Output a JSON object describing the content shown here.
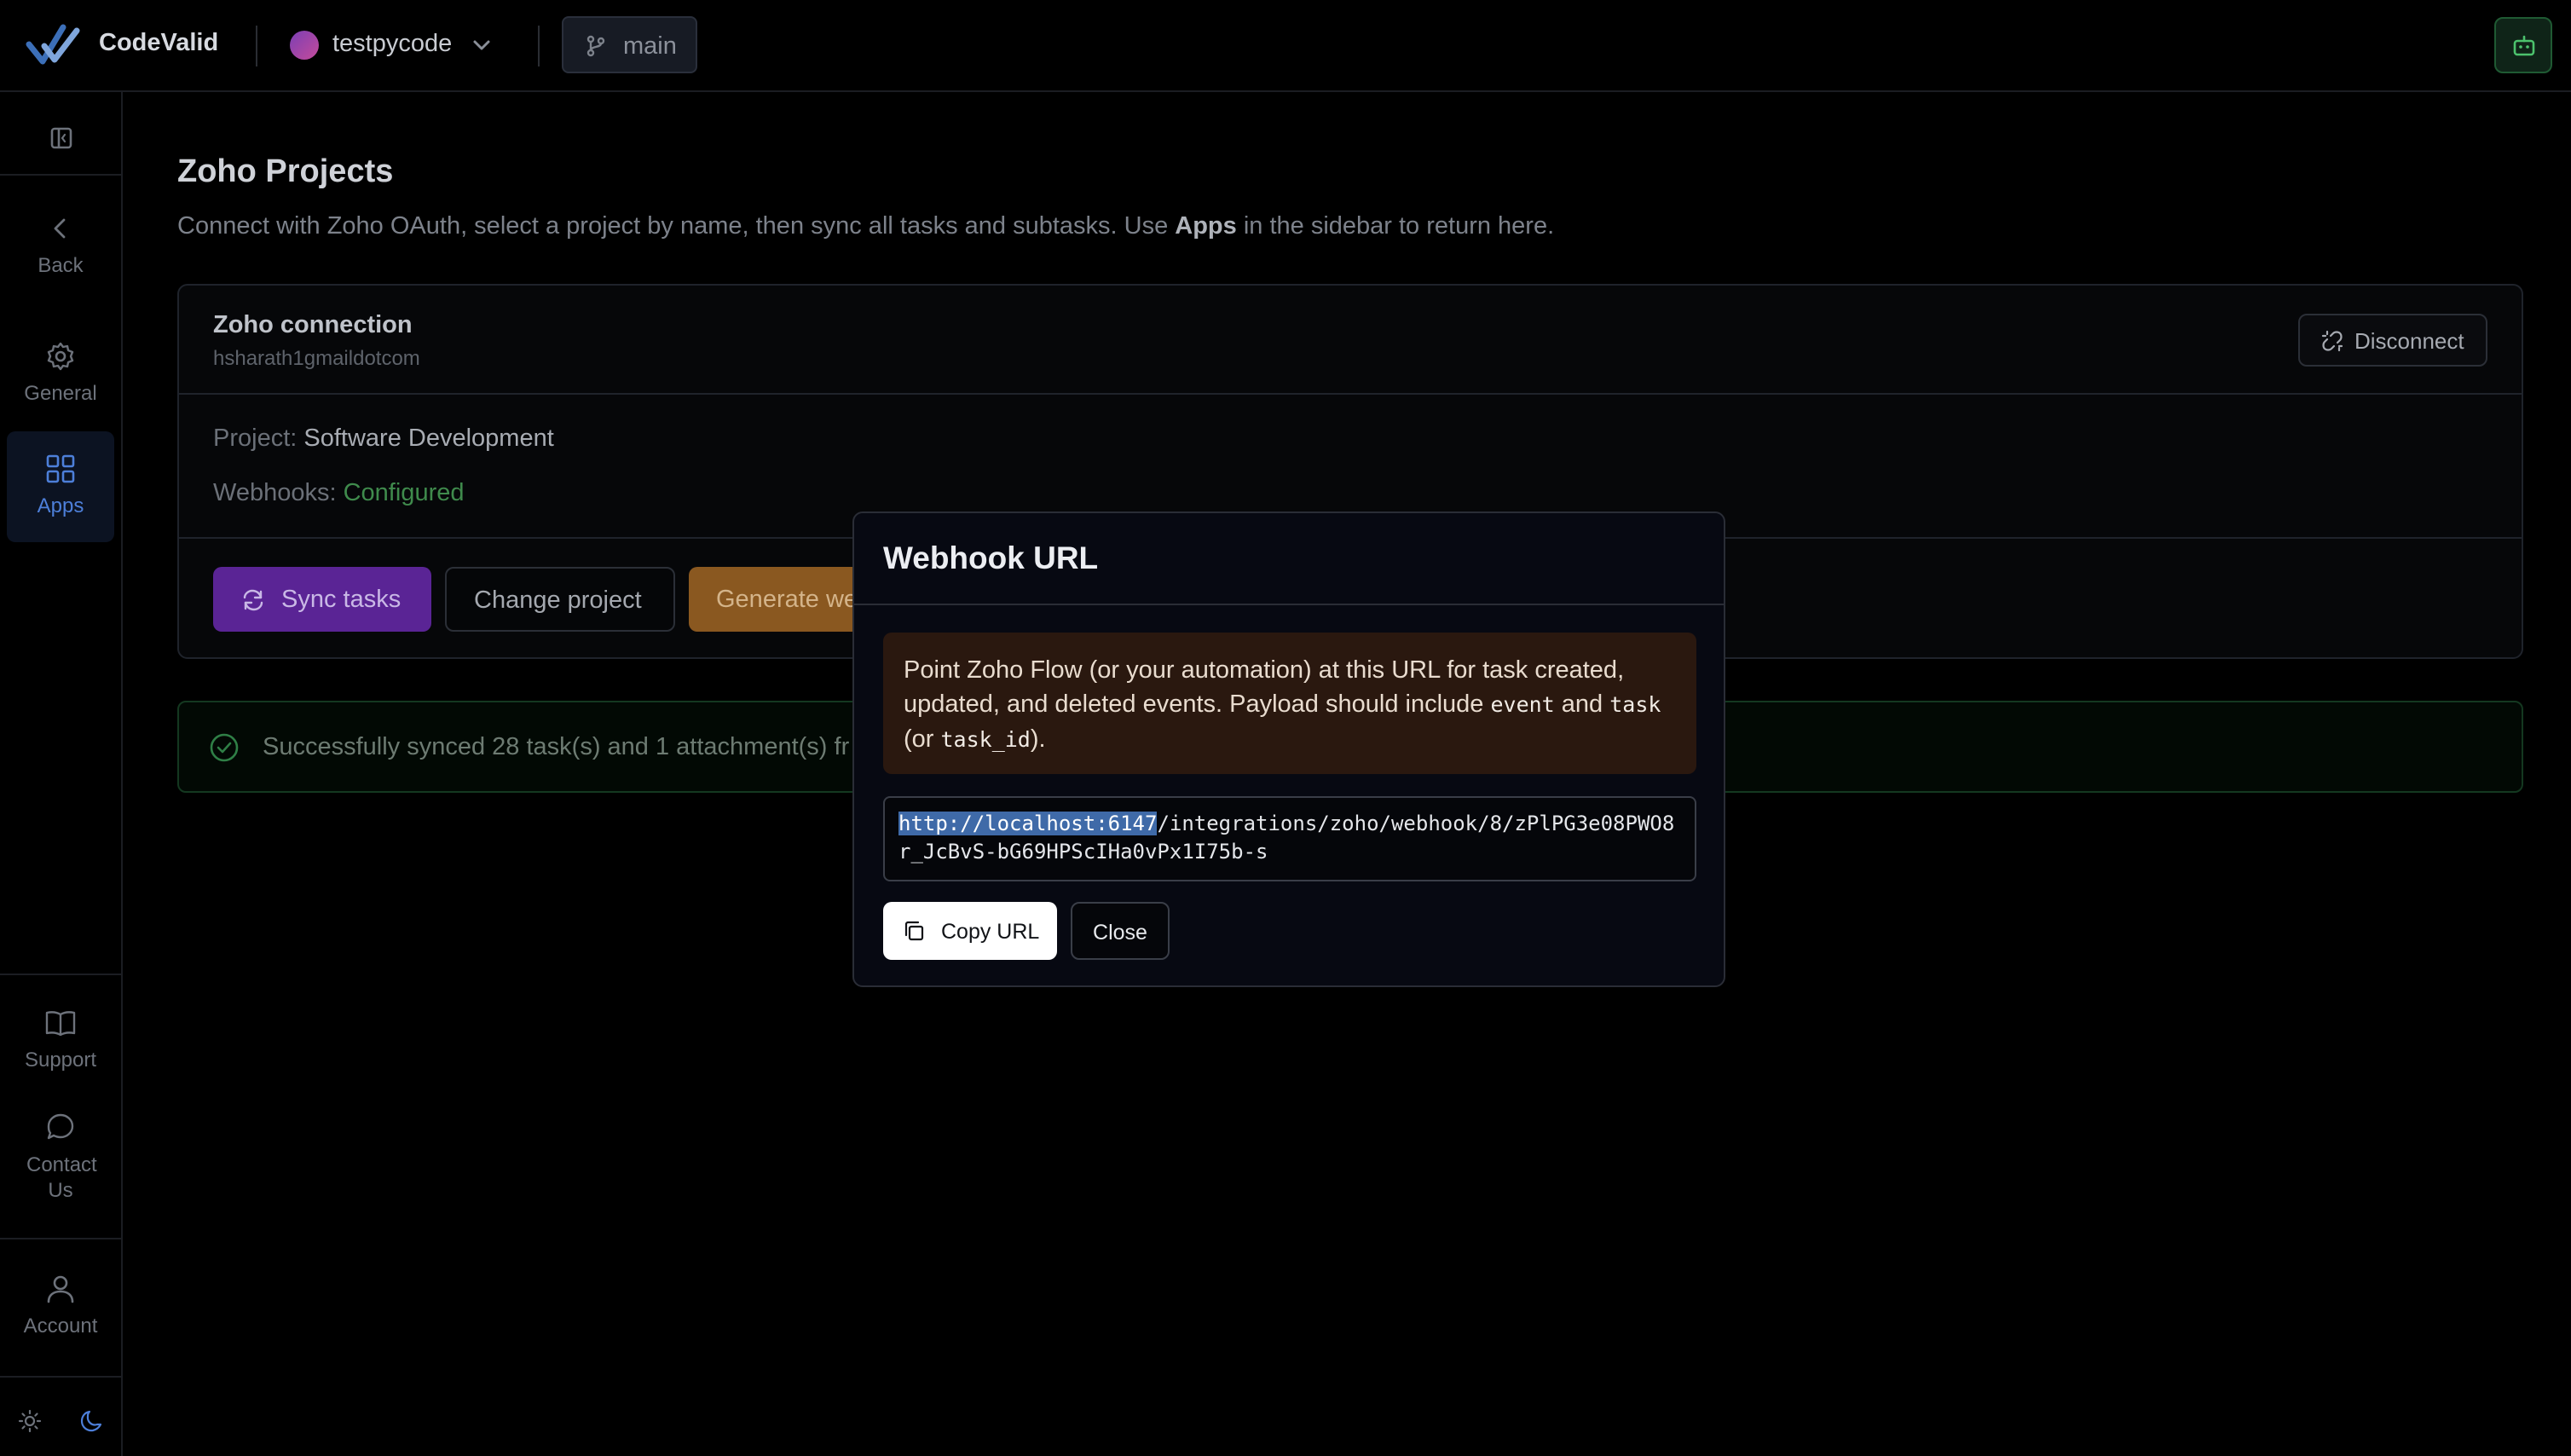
{
  "app": {
    "name": "CodeValid",
    "accent": "#5a2495"
  },
  "header": {
    "project_name": "testpycode",
    "branch": "main"
  },
  "rail": {
    "items": [
      {
        "label": "Back",
        "icon": "chevron-left-icon"
      },
      {
        "label": "General",
        "icon": "gear-icon"
      },
      {
        "label": "Apps",
        "icon": "grid-icon",
        "active": true
      },
      {
        "label": "Support",
        "icon": "book-icon"
      },
      {
        "label": "Contact Us",
        "icon": "chat-icon"
      },
      {
        "label": "Account",
        "icon": "user-icon"
      }
    ]
  },
  "page": {
    "title": "Zoho Projects",
    "desc_before": "Connect with Zoho OAuth, select a project by name, then sync all tasks and subtasks. Use ",
    "desc_strong": "Apps",
    "desc_after": " in the sidebar to return here."
  },
  "connection": {
    "title": "Zoho connection",
    "account": "hsharath1gmaildotcom",
    "disconnect_label": "Disconnect",
    "project_label": "Project:",
    "project_value": "Software Development",
    "webhooks_label": "Webhooks:",
    "webhooks_value": "Configured",
    "webhooks_color": "#3f8a4c",
    "buttons": {
      "sync": "Sync tasks",
      "change": "Change project",
      "generate": "Generate we"
    }
  },
  "alert": {
    "text": "Successfully synced 28 task(s) and 1 attachment(s) fr"
  },
  "modal": {
    "title": "Webhook URL",
    "note": {
      "p1": "Point Zoho Flow (or your automation) at this URL for task created, updated, and deleted events. Payload should include ",
      "code1": "event",
      "p2": " and ",
      "code2": "task",
      "p3": " (or ",
      "code3": "task_id",
      "p4": ")."
    },
    "url_selected": "http://localhost:6147",
    "url_rest": "/integrations/zoho/webhook/8/zPlPG3e08PWO8r_JcBvS-bG69HPScIHa0vPx1I75b-s",
    "copy_label": "Copy URL",
    "close_label": "Close"
  }
}
